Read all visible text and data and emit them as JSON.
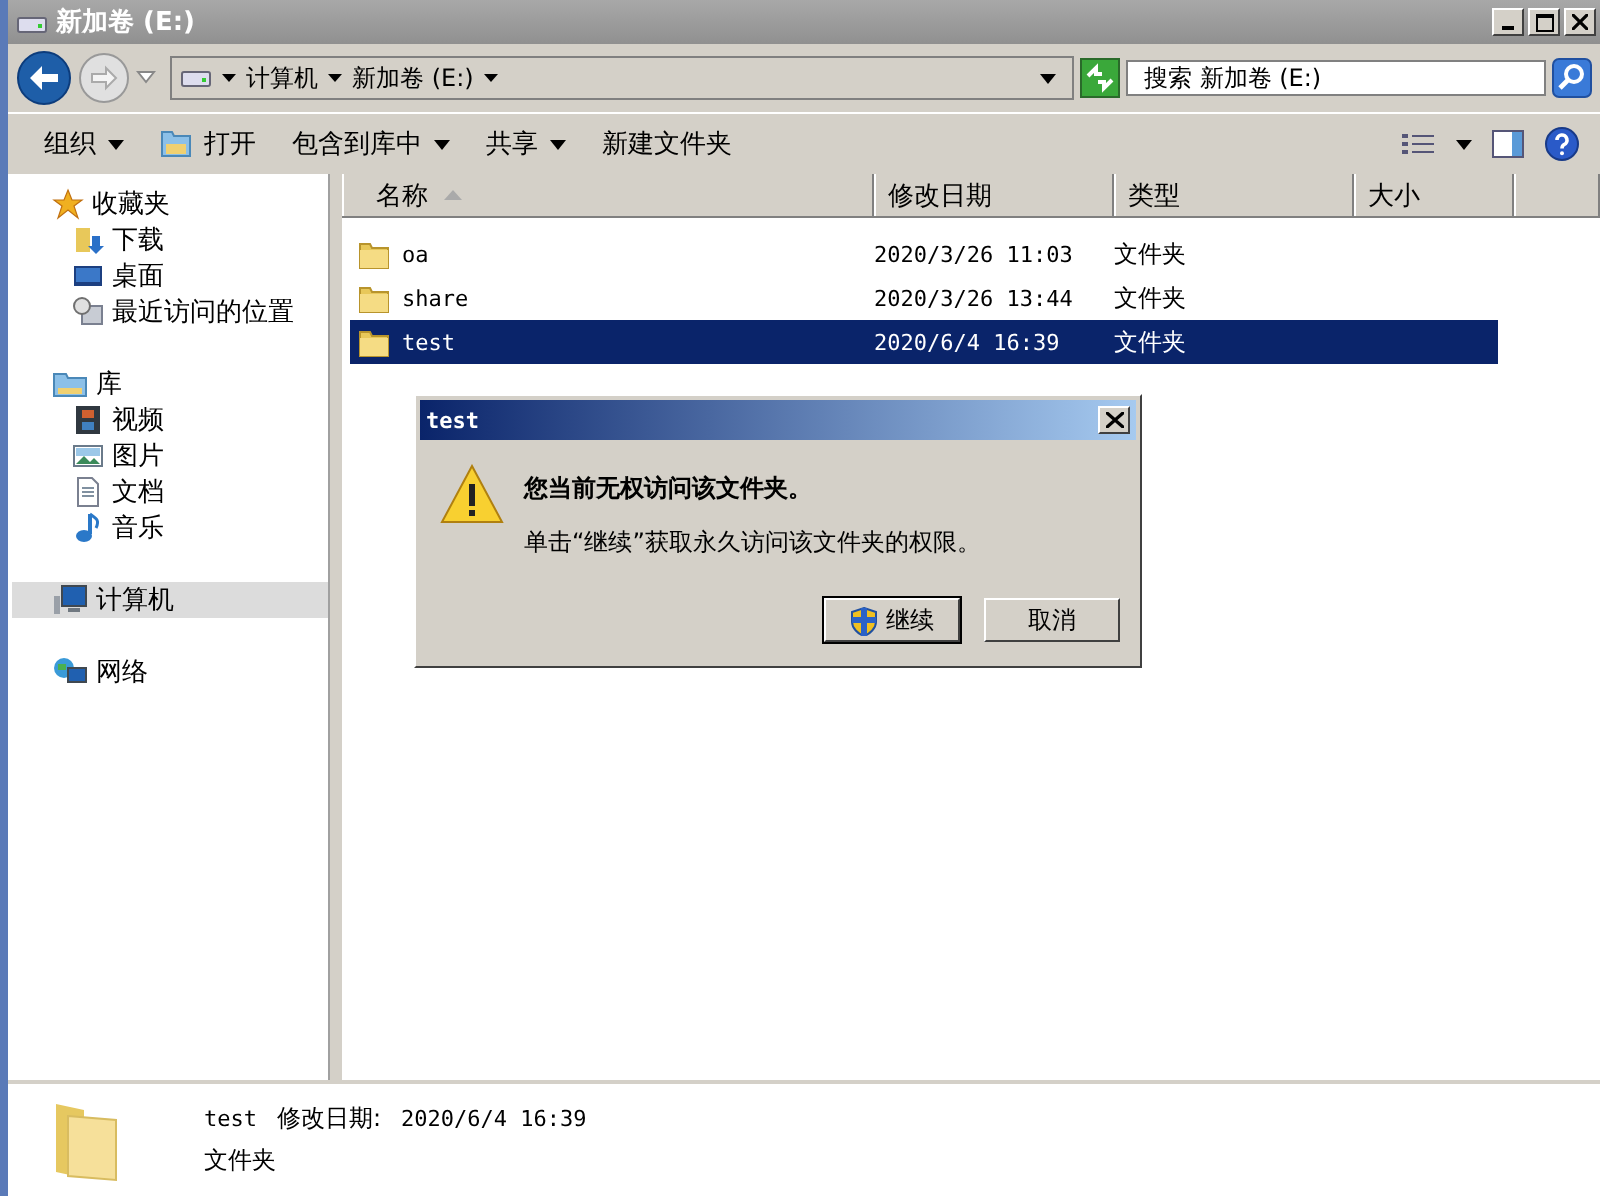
{
  "window": {
    "title": "新加卷 (E:)"
  },
  "address": {
    "crumbs": [
      "计算机",
      "新加卷 (E:)"
    ]
  },
  "search": {
    "placeholder": "搜索 新加卷 (E:)"
  },
  "toolbar": {
    "items": [
      {
        "label": "组织",
        "dropdown": true
      },
      {
        "label": "打开",
        "dropdown": false,
        "kind": "open"
      },
      {
        "label": "包含到库中",
        "dropdown": true
      },
      {
        "label": "共享",
        "dropdown": true
      },
      {
        "label": "新建文件夹",
        "dropdown": false
      }
    ]
  },
  "sidebar": {
    "groups": [
      {
        "label": "收藏夹",
        "selected": false,
        "children": [
          {
            "label": "下载",
            "selected": false
          },
          {
            "label": "桌面",
            "selected": false
          },
          {
            "label": "最近访问的位置",
            "selected": false
          }
        ]
      },
      {
        "label": "库",
        "selected": false,
        "children": [
          {
            "label": "视频",
            "selected": false
          },
          {
            "label": "图片",
            "selected": false
          },
          {
            "label": "文档",
            "selected": false
          },
          {
            "label": "音乐",
            "selected": false
          }
        ]
      },
      {
        "label": "计算机",
        "selected": true
      },
      {
        "label": "网络",
        "selected": false
      }
    ]
  },
  "table": {
    "columns": [
      {
        "label": "名称",
        "sorted": true
      },
      {
        "label": "修改日期",
        "sorted": false
      },
      {
        "label": "类型",
        "sorted": false
      },
      {
        "label": "大小",
        "sorted": false
      }
    ],
    "rows": [
      {
        "name": "oa",
        "date": "2020/3/26 11:03",
        "type": "文件夹",
        "selected": false
      },
      {
        "name": "share",
        "date": "2020/3/26 13:44",
        "type": "文件夹",
        "selected": false
      },
      {
        "name": "test",
        "date": "2020/6/4 16:39",
        "type": "文件夹",
        "selected": true
      }
    ]
  },
  "dialog": {
    "title": "test",
    "heading": "您当前无权访问该文件夹。",
    "message": "单击“继续”获取永久访问该文件夹的权限。",
    "buttons": [
      {
        "label": "继续",
        "kind": "shield"
      },
      {
        "label": "取消",
        "kind": "plain"
      }
    ]
  },
  "status_bar": {
    "name": "test",
    "date_label": "修改日期:",
    "date": "2020/6/4 16:39",
    "type": "文件夹"
  }
}
